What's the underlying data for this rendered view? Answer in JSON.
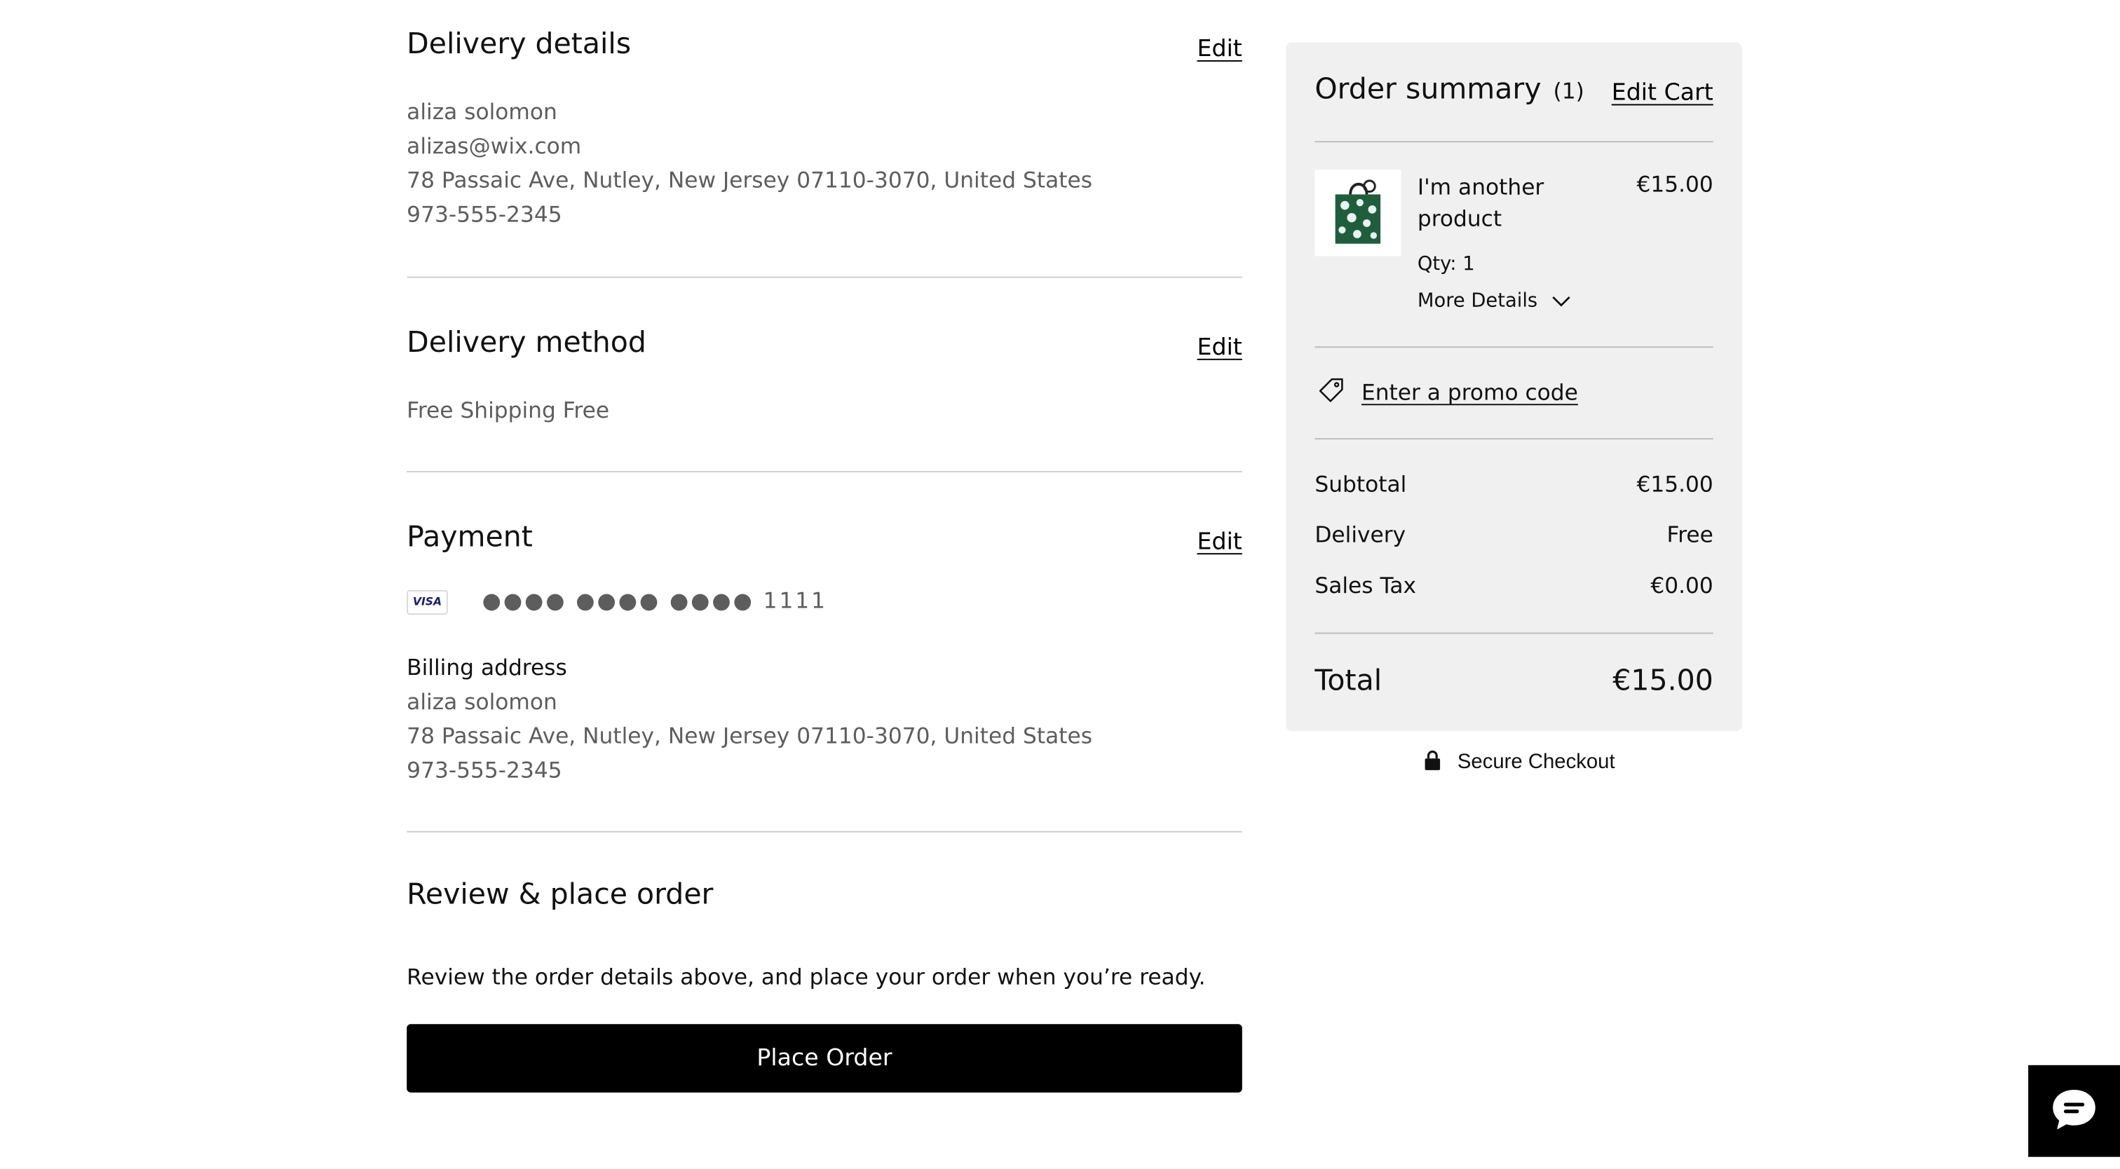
{
  "delivery_details": {
    "title": "Delivery details",
    "edit_label": "Edit",
    "name": "aliza solomon",
    "email": "alizas@wix.com",
    "address": "78 Passaic Ave, Nutley, New Jersey 07110-3070, United States",
    "phone": "973-555-2345"
  },
  "delivery_method": {
    "title": "Delivery method",
    "edit_label": "Edit",
    "method": "Free Shipping Free"
  },
  "payment": {
    "title": "Payment",
    "edit_label": "Edit",
    "card_brand": "VISA",
    "card_number": "●●●● ●●●● ●●●● 1111",
    "billing_label": "Billing address",
    "billing_name": "aliza solomon",
    "billing_address": "78 Passaic Ave, Nutley, New Jersey 07110-3070, United States",
    "billing_phone": "973-555-2345"
  },
  "review": {
    "title": "Review & place order",
    "description": "Review the order details above, and place your order when you’re ready.",
    "button_label": "Place Order"
  },
  "order_summary": {
    "title": "Order summary",
    "count": "(1)",
    "edit_cart_label": "Edit Cart",
    "product": {
      "name": "I'm another product",
      "price": "€15.00",
      "qty": "Qty: 1",
      "more_details": "More Details"
    },
    "promo_label": "Enter a promo code",
    "subtotal_label": "Subtotal",
    "subtotal_value": "€15.00",
    "delivery_label": "Delivery",
    "delivery_value": "Free",
    "tax_label": "Sales Tax",
    "tax_value": "€0.00",
    "total_label": "Total",
    "total_value": "€15.00"
  },
  "secure_checkout": "Secure Checkout",
  "colors": {
    "accent": "#000000",
    "summary_bg": "#f0f0f0",
    "muted_text": "#5d5d5d",
    "product_green": "#1f5e3d"
  },
  "icons": {
    "promo": "tag-icon",
    "secure": "lock-icon",
    "chat": "chat-bubble-icon",
    "more_details": "chevron-down-icon"
  }
}
